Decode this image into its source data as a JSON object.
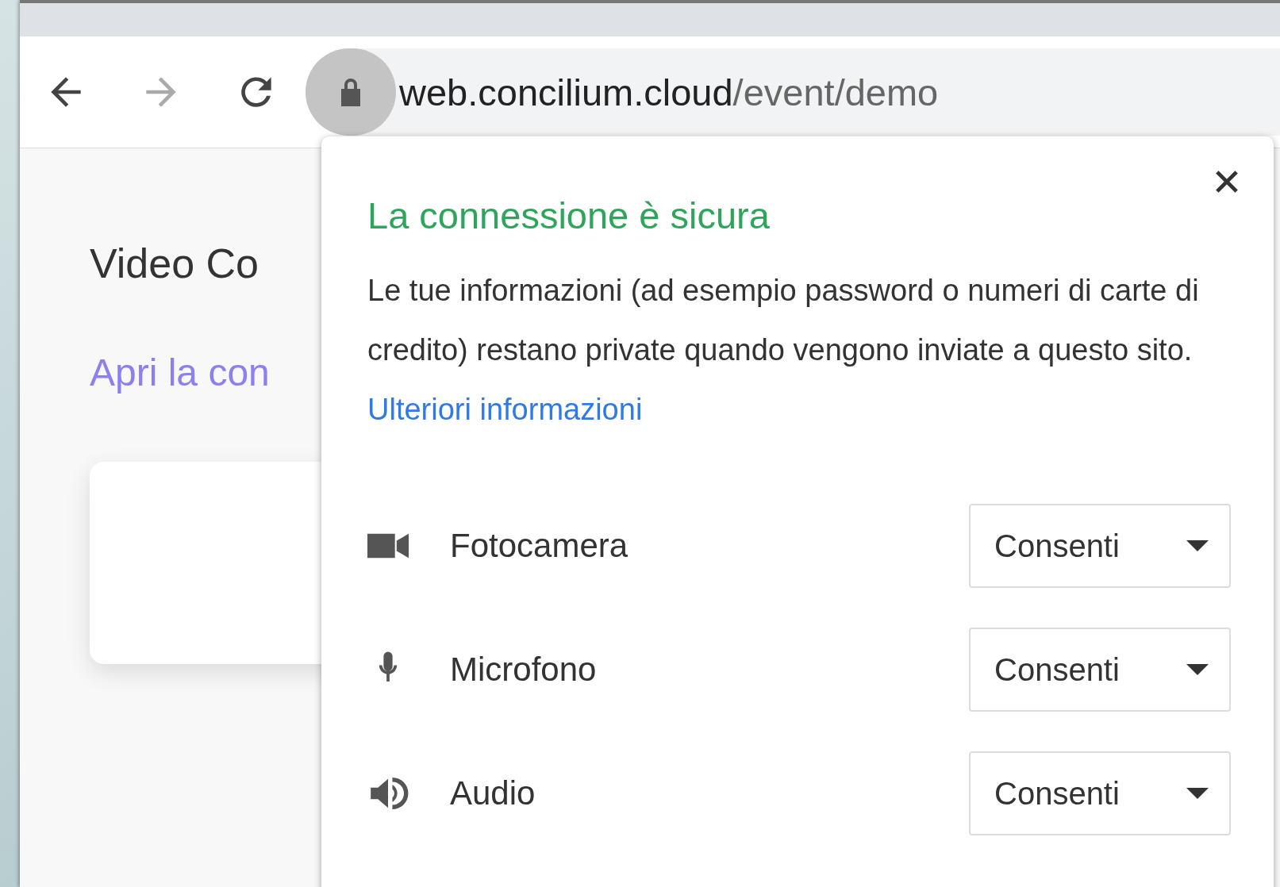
{
  "browser": {
    "url_host": "web.concilium.cloud",
    "url_path": "/event/demo"
  },
  "page": {
    "heading": "Video Co",
    "link": "Apri la con"
  },
  "site_info": {
    "title": "La connessione è sicura",
    "description": "Le tue informazioni (ad esempio password o numeri di carte di credito) restano private quando vengono inviate a questo sito.",
    "learn_more": "Ulteriori informazioni",
    "permissions": [
      {
        "kind": "camera",
        "label": "Fotocamera",
        "value": "Consenti"
      },
      {
        "kind": "microphone",
        "label": "Microfono",
        "value": "Consenti"
      },
      {
        "kind": "sound",
        "label": "Audio",
        "value": "Consenti"
      }
    ]
  }
}
